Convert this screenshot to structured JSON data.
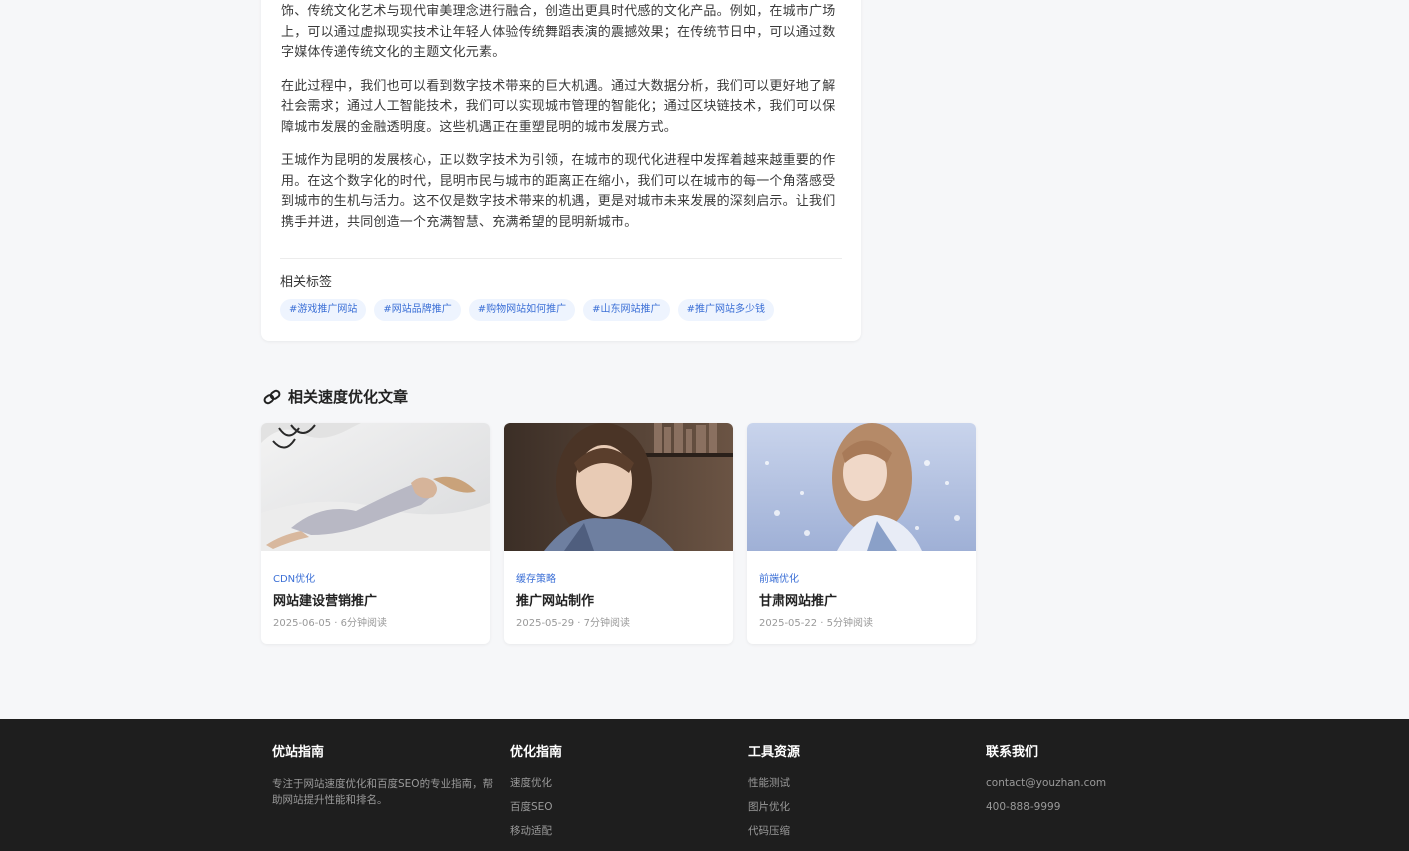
{
  "article": {
    "paragraphs": [
      "饰、传统文化艺术与现代审美理念进行融合，创造出更具时代感的文化产品。例如，在城市广场上，可以通过虚拟现实技术让年轻人体验传统舞蹈表演的震撼效果；在传统节日中，可以通过数字媒体传递传统文化的主题文化元素。",
      "在此过程中，我们也可以看到数字技术带来的巨大机遇。通过大数据分析，我们可以更好地了解社会需求；通过人工智能技术，我们可以实现城市管理的智能化；通过区块链技术，我们可以保障城市发展的金融透明度。这些机遇正在重塑昆明的城市发展方式。",
      "王城作为昆明的发展核心，正以数字技术为引领，在城市的现代化进程中发挥着越来越重要的作用。在这个数字化的时代，昆明市民与城市的距离正在缩小，我们可以在城市的每一个角落感受到城市的生机与活力。这不仅是数字技术带来的机遇，更是对城市未来发展的深刻启示。让我们携手并进，共同创造一个充满智慧、充满希望的昆明新城市。"
    ],
    "tags_title": "相关标签",
    "tags": [
      "#游戏推广网站",
      "#网站品牌推广",
      "#购物网站如何推广",
      "#山东网站推广",
      "#推广网站多少钱"
    ]
  },
  "related": {
    "heading": "相关速度优化文章",
    "icon": "link-icon",
    "cards": [
      {
        "category": "CDN优化",
        "title": "网站建设营销推广",
        "meta": "2025-06-05 · 6分钟阅读"
      },
      {
        "category": "缓存策略",
        "title": "推广网站制作",
        "meta": "2025-05-29 · 7分钟阅读"
      },
      {
        "category": "前端优化",
        "title": "甘肃网站推广",
        "meta": "2025-05-22 · 5分钟阅读"
      }
    ]
  },
  "footer": {
    "brand": {
      "title": "优站指南",
      "desc": "专注于网站速度优化和百度SEO的专业指南，帮助网站提升性能和排名。"
    },
    "guides": {
      "title": "优化指南",
      "links": [
        "速度优化",
        "百度SEO",
        "移动适配"
      ]
    },
    "tools": {
      "title": "工具资源",
      "links": [
        "性能测试",
        "图片优化",
        "代码压缩"
      ]
    },
    "contact": {
      "title": "联系我们",
      "email": "contact@youzhan.com",
      "phone": "400-888-9999"
    }
  },
  "colors": {
    "accent": "#3b6fd6",
    "tag_bg": "#eef4fe",
    "footer_bg": "#1e1e1e",
    "page_bg": "#f6f7f9"
  }
}
